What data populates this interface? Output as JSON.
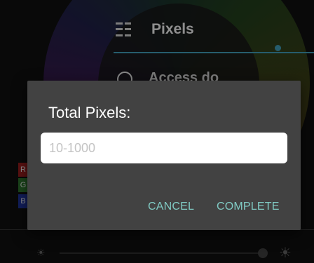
{
  "background": {
    "title": "Pixels",
    "row_label": "Access do",
    "rgb_labels": [
      "R",
      "G",
      "B"
    ],
    "icons": [
      "grid-icon",
      "clock-icon",
      "brightness-low-icon",
      "brightness-high-icon"
    ]
  },
  "dialog": {
    "title": "Total Pixels:",
    "input": {
      "placeholder": "10-1000",
      "value": ""
    },
    "buttons": {
      "cancel": "CANCEL",
      "complete": "COMPLETE"
    }
  },
  "colors": {
    "accent": "#80cbc4",
    "dialog_bg": "#424242",
    "background": "#0e0e0e",
    "line": "#3b8fa8"
  }
}
